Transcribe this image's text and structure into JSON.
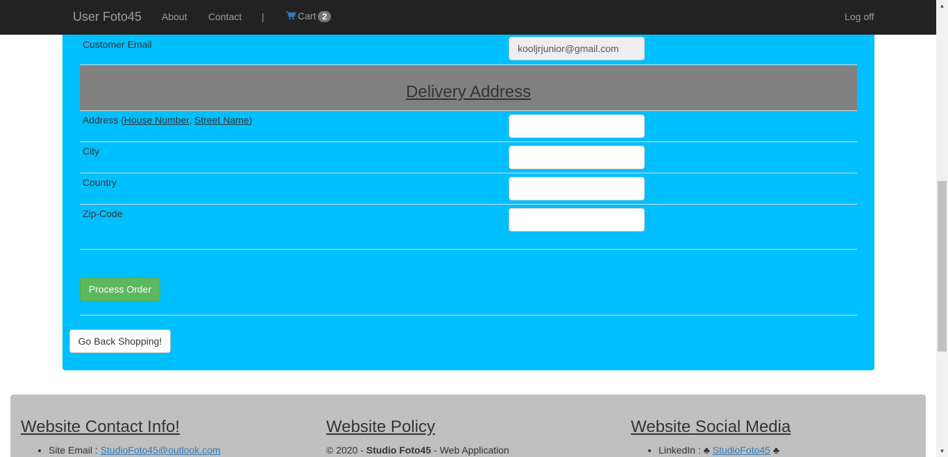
{
  "navbar": {
    "brand": "User Foto45",
    "about": "About",
    "contact": "Contact",
    "separator": "|",
    "cart_label": "Cart",
    "cart_count": "2",
    "logoff": "Log off"
  },
  "form": {
    "customer_email_label": "Customer Email",
    "customer_email_value": "kooljrjunior@gmail.com",
    "delivery_title": "Delivery Address",
    "address_label": "Address (",
    "address_hint1": "House Number",
    "address_sep": ", ",
    "address_hint2": "Street Name",
    "address_end": ")",
    "address_value": "",
    "city_label": "City",
    "city_value": "",
    "country_label": "Country",
    "country_value": "",
    "zip_label": "Zip-Code",
    "zip_value": "",
    "process_button": "Process Order",
    "back_button": "Go Back Shopping!"
  },
  "footer": {
    "contact_title": "Website Contact Info!",
    "site_email_label": "Site Email : ",
    "site_email": "StudioFoto45@outlook.com",
    "policy_title": "Website Policy",
    "policy_prefix": "© 2020 - ",
    "policy_brand": "Studio Foto45",
    "policy_suffix": " - Web Application",
    "social_title": "Website Social Media",
    "linkedin_label": "LinkedIn : ",
    "linkedin_symbol": "♣",
    "linkedin_link": "StudioFoto45"
  },
  "colors": {
    "navbar": "#222222",
    "panel": "#00bfff",
    "delivery_header": "#808080",
    "process_button": "#5cb85c",
    "footer": "#c0c0c0",
    "cart_icon": "#337ab7"
  }
}
